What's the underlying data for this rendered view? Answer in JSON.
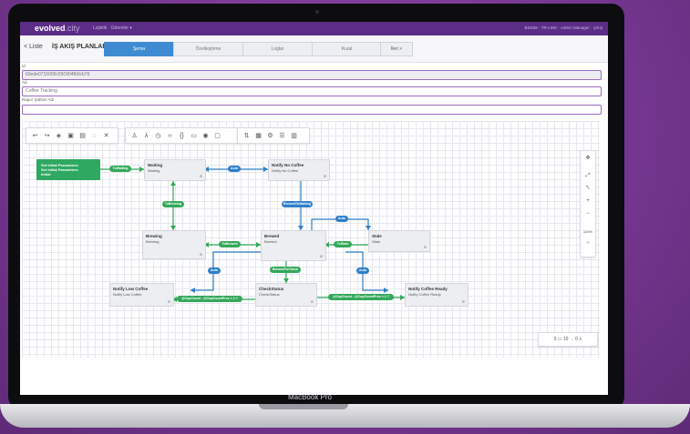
{
  "app": {
    "logo": "evolved",
    "logo_suffix": ".city",
    "menu": "Lojistik · Görevler ▾",
    "user_info": "BSD06 · TR-LINK · Admin Manager · Çıkış",
    "device_label": "MacBook Pro"
  },
  "toolbar": {
    "back_label": "< Liste",
    "page_title": "İŞ AKIŞ PLANLARI",
    "steps": [
      "Şema",
      "Özelleştirme",
      "Loglar",
      "Kural"
    ],
    "next_label": "İleri >"
  },
  "form": {
    "id_label": "Id",
    "id_value": "60ede0715005c55f1f04fb0cb76",
    "name_label": "Ad",
    "name_value": "Coffee Tracking",
    "report_label": "Rapor Şablon Adı",
    "report_value": ""
  },
  "canvas": {
    "side_tools": [
      "✥",
      "⤢",
      "⤣",
      "+",
      "−",
      "100%",
      "○"
    ],
    "mini_bar": "0 ▭  10 →  0 ⅄",
    "nodes": {
      "start": [
        "Set Initial Parameters",
        "Set Initial Parameters",
        "Initial"
      ],
      "waiting": [
        "Waiting",
        "Waiting"
      ],
      "notify_no_coffee": [
        "Notify No Coffee",
        "Notify No Coffee"
      ],
      "brewing": [
        "Brewing",
        "Brewing"
      ],
      "brewed": [
        "Brewed",
        "Brewed"
      ],
      "stale": [
        "Stale",
        "Stale"
      ],
      "notify_low": [
        "Notify Low Coffee",
        "Notify Low Coffee"
      ],
      "check_status": [
        "CheckStatus",
        "CheckStatus"
      ],
      "notify_ready": [
        "Notify Coffee Ready",
        "Notify Coffee Ready"
      ]
    },
    "labels": {
      "to_waiting": "ToWaiting",
      "auto_1": "Auto",
      "to_brewing": "ToBrewing",
      "brewed_to_waiting": "BrewedToWaiting",
      "auto_2": "Auto",
      "to_brewed": "ToBrewed",
      "to_stale": "ToStale",
      "brewed_to_check": "BrewedToCheck",
      "auto_3": "Auto",
      "auto_4": "Auto",
      "cup_low": "@CupCount - @CupCountPrev < 2 ?",
      "cup_ready": "@CupCount - @CupCountPrev > 2 ?",
      "e": "E"
    }
  }
}
